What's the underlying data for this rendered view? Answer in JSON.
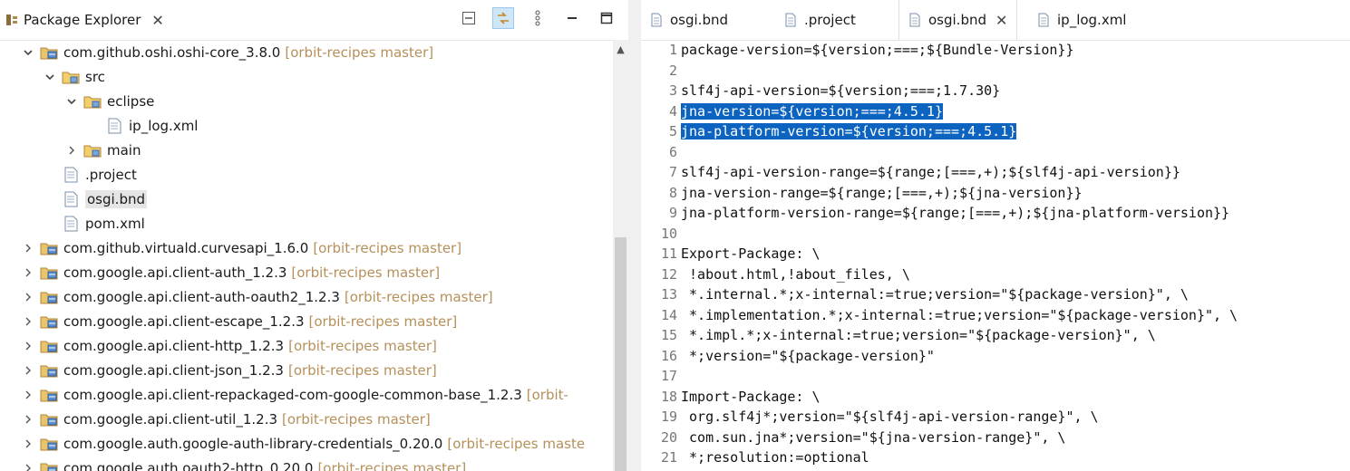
{
  "package_explorer": {
    "title": "Package Explorer",
    "close": "✕",
    "tree": [
      {
        "indent": 0,
        "twisty": "open",
        "icon": "project-icon",
        "label": "com.github.oshi.oshi-core_3.8.0",
        "decoration": "[orbit-recipes master]"
      },
      {
        "indent": 1,
        "twisty": "open",
        "icon": "folder-icon",
        "label": "src",
        "decoration": ""
      },
      {
        "indent": 2,
        "twisty": "open",
        "icon": "folder-icon",
        "label": "eclipse",
        "decoration": ""
      },
      {
        "indent": 3,
        "twisty": "none",
        "icon": "file-icon",
        "label": "ip_log.xml",
        "decoration": ""
      },
      {
        "indent": 2,
        "twisty": "closed",
        "icon": "folder-icon",
        "label": "main",
        "decoration": ""
      },
      {
        "indent": 1,
        "twisty": "none",
        "icon": "file-icon",
        "label": ".project",
        "decoration": ""
      },
      {
        "indent": 1,
        "twisty": "none",
        "icon": "file-icon",
        "label": "osgi.bnd",
        "decoration": "",
        "selected": true
      },
      {
        "indent": 1,
        "twisty": "none",
        "icon": "file-icon",
        "label": "pom.xml",
        "decoration": ""
      },
      {
        "indent": 0,
        "twisty": "closed",
        "icon": "project-icon",
        "label": "com.github.virtuald.curvesapi_1.6.0",
        "decoration": "[orbit-recipes master]"
      },
      {
        "indent": 0,
        "twisty": "closed",
        "icon": "project-icon",
        "label": "com.google.api.client-auth_1.2.3",
        "decoration": "[orbit-recipes master]"
      },
      {
        "indent": 0,
        "twisty": "closed",
        "icon": "project-icon",
        "label": "com.google.api.client-auth-oauth2_1.2.3",
        "decoration": "[orbit-recipes master]"
      },
      {
        "indent": 0,
        "twisty": "closed",
        "icon": "project-icon",
        "label": "com.google.api.client-escape_1.2.3",
        "decoration": "[orbit-recipes master]"
      },
      {
        "indent": 0,
        "twisty": "closed",
        "icon": "project-icon",
        "label": "com.google.api.client-http_1.2.3",
        "decoration": "[orbit-recipes master]"
      },
      {
        "indent": 0,
        "twisty": "closed",
        "icon": "project-icon",
        "label": "com.google.api.client-json_1.2.3",
        "decoration": "[orbit-recipes master]"
      },
      {
        "indent": 0,
        "twisty": "closed",
        "icon": "project-icon",
        "label": "com.google.api.client-repackaged-com-google-common-base_1.2.3",
        "decoration": "[orbit-"
      },
      {
        "indent": 0,
        "twisty": "closed",
        "icon": "project-icon",
        "label": "com.google.api.client-util_1.2.3",
        "decoration": "[orbit-recipes master]"
      },
      {
        "indent": 0,
        "twisty": "closed",
        "icon": "project-icon",
        "label": "com.google.auth.google-auth-library-credentials_0.20.0",
        "decoration": "[orbit-recipes maste"
      },
      {
        "indent": 0,
        "twisty": "closed",
        "icon": "project-icon",
        "label": "com.google.auth.oauth2-http_0.20.0",
        "decoration": "[orbit-recipes master]"
      }
    ]
  },
  "editor": {
    "tabs": [
      {
        "label": "osgi.bnd",
        "active": false
      },
      {
        "label": ".project",
        "active": false
      },
      {
        "label": "osgi.bnd",
        "active": true,
        "close": "✕"
      },
      {
        "label": "ip_log.xml",
        "active": false
      }
    ],
    "lines": [
      {
        "n": "1",
        "text": "package-version=${version;===;${Bundle-Version}}"
      },
      {
        "n": "2",
        "text": ""
      },
      {
        "n": "3",
        "text": "slf4j-api-version=${version;===;1.7.30}"
      },
      {
        "n": "4",
        "text": "jna-version=${version;===;4.5.1}",
        "highlight": true
      },
      {
        "n": "5",
        "text": "jna-platform-version=${version;===;4.5.1}",
        "highlight": true
      },
      {
        "n": "6",
        "text": ""
      },
      {
        "n": "7",
        "text": "slf4j-api-version-range=${range;[===,+);${slf4j-api-version}}"
      },
      {
        "n": "8",
        "text": "jna-version-range=${range;[===,+);${jna-version}}"
      },
      {
        "n": "9",
        "text": "jna-platform-version-range=${range;[===,+);${jna-platform-version}}"
      },
      {
        "n": "10",
        "text": ""
      },
      {
        "n": "11",
        "text": "Export-Package: \\"
      },
      {
        "n": "12",
        "text": " !about.html,!about_files, \\"
      },
      {
        "n": "13",
        "text": " *.internal.*;x-internal:=true;version=\"${package-version}\", \\"
      },
      {
        "n": "14",
        "text": " *.implementation.*;x-internal:=true;version=\"${package-version}\", \\"
      },
      {
        "n": "15",
        "text": " *.impl.*;x-internal:=true;version=\"${package-version}\", \\"
      },
      {
        "n": "16",
        "text": " *;version=\"${package-version}\""
      },
      {
        "n": "17",
        "text": ""
      },
      {
        "n": "18",
        "text": "Import-Package: \\"
      },
      {
        "n": "19",
        "text": " org.slf4j*;version=\"${slf4j-api-version-range}\", \\"
      },
      {
        "n": "20",
        "text": " com.sun.jna*;version=\"${jna-version-range}\", \\"
      },
      {
        "n": "21",
        "text": " *;resolution:=optional"
      }
    ]
  },
  "colors": {
    "accent": "#0c64c0",
    "decoration": "#b6905a",
    "selection": "#e5e5e5"
  }
}
